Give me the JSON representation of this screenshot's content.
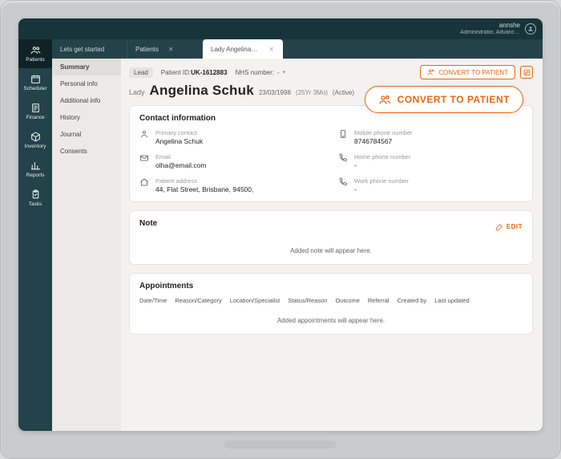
{
  "header": {
    "user_name": "annshe",
    "user_role": "Administrator, Advanc…"
  },
  "rail": [
    {
      "id": "patients",
      "label": "Patients",
      "icon": "users-icon",
      "active": true
    },
    {
      "id": "scheduler",
      "label": "Scheduler",
      "icon": "calendar-icon"
    },
    {
      "id": "finance",
      "label": "Finance",
      "icon": "bill-icon"
    },
    {
      "id": "inventory",
      "label": "Inventory",
      "icon": "cube-icon"
    },
    {
      "id": "reports",
      "label": "Reports",
      "icon": "barchart-icon"
    },
    {
      "id": "tasks",
      "label": "Tasks",
      "icon": "clipboard-icon"
    }
  ],
  "tabs": [
    {
      "label": "Lets get started",
      "closable": false
    },
    {
      "label": "Patients",
      "closable": true
    },
    {
      "label": "Lady Angelina Schuk",
      "closable": true,
      "active": true
    }
  ],
  "sidelist": [
    {
      "label": "Summary",
      "active": true
    },
    {
      "label": "Personal info"
    },
    {
      "label": "Additional info"
    },
    {
      "label": "History"
    },
    {
      "label": "Journal"
    },
    {
      "label": "Consents"
    }
  ],
  "toprow": {
    "badge": "Lead",
    "patient_id_label": "Patient ID:",
    "patient_id_value": "UK-1612883",
    "nhs_label": "NHS number:",
    "nhs_value": "-",
    "convert_small": "CONVERT TO PATIENT"
  },
  "title": {
    "prefix": "Lady",
    "name": "Angelina Schuk",
    "dob": "23/03/1998",
    "age": "(25Yr 3Mo)",
    "status": "(Active)"
  },
  "convert_big": "CONVERT TO PATIENT",
  "contact": {
    "heading": "Contact information",
    "primary_label": "Primary contact",
    "primary_value": "Angelina Schuk",
    "mobile_label": "Mobile phone number",
    "mobile_value": "8746784567",
    "email_label": "Email",
    "email_value": "olha@email.com",
    "home_label": "Home phone number",
    "home_value": "-",
    "address_label": "Patient address",
    "address_value": "44, Flat Street, Brisbane, 94500,",
    "work_label": "Work phone number",
    "work_value": "-"
  },
  "note": {
    "heading": "Note",
    "edit": "EDIT",
    "placeholder": "Added note will appear here."
  },
  "appointments": {
    "heading": "Appointments",
    "cols": [
      "Date/Time",
      "Reason/Category",
      "Location/Specialist",
      "Status/Reason",
      "Outcome",
      "Referral",
      "Created by",
      "Last updated"
    ],
    "placeholder": "Added appointments will appear here."
  },
  "colors": {
    "accent": "#e9660f"
  }
}
